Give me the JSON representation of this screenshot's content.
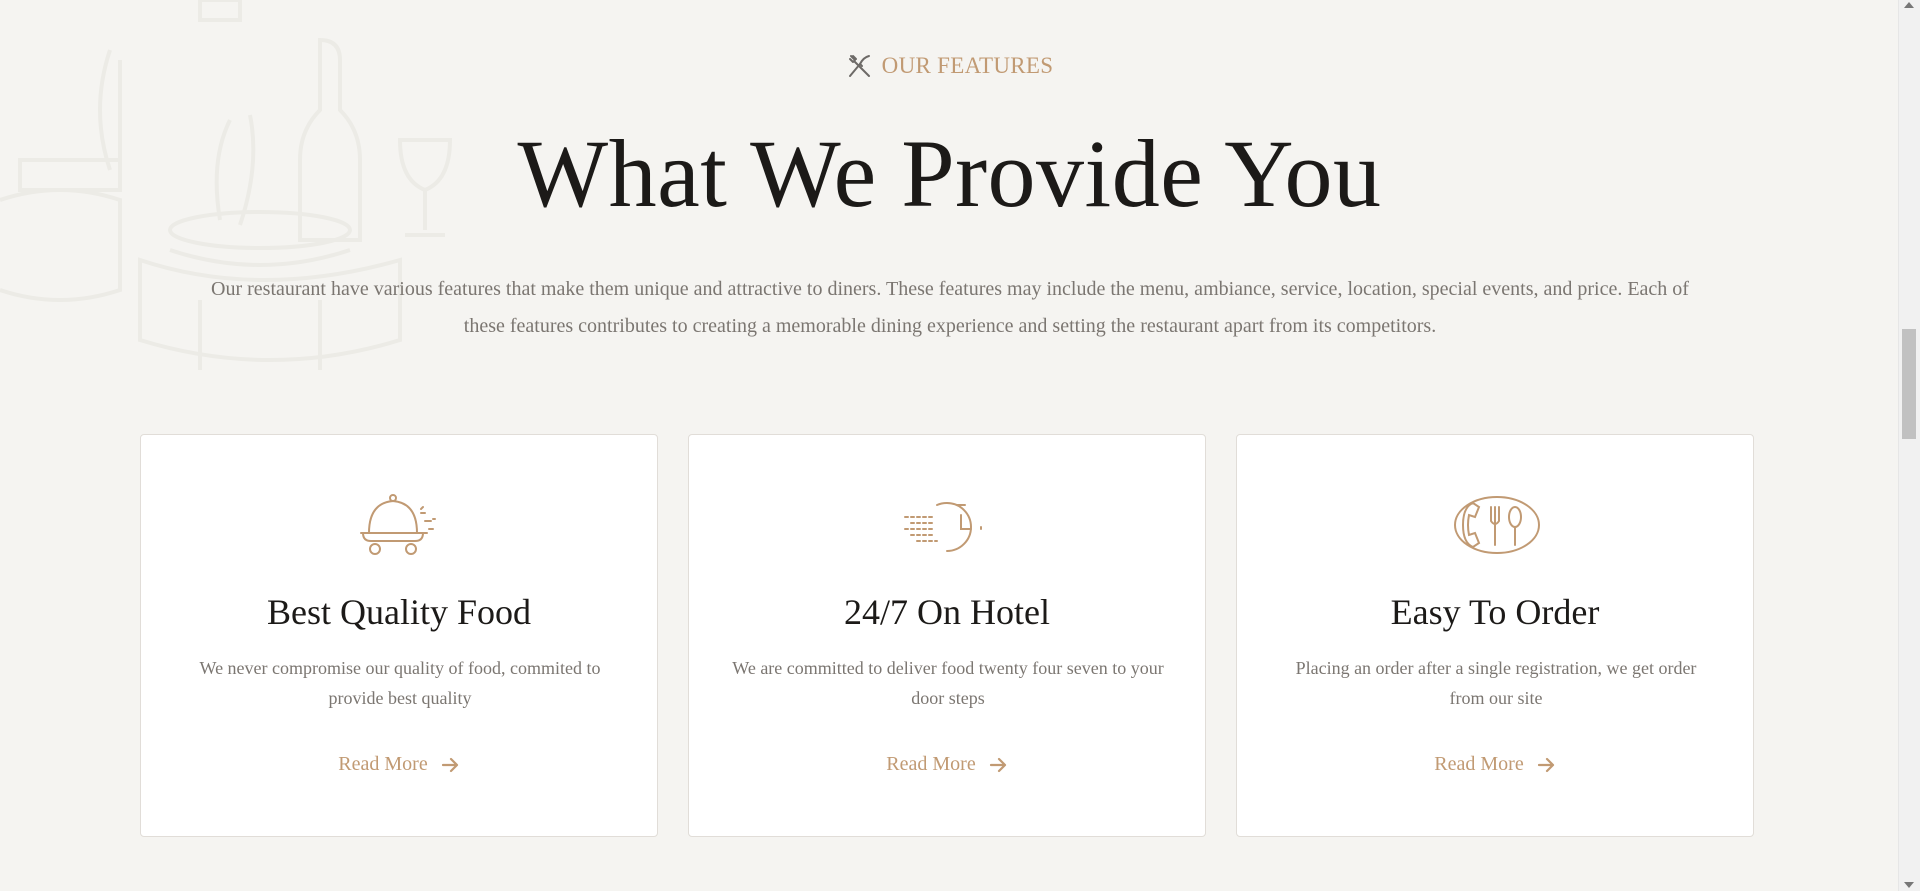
{
  "section": {
    "tag": "OUR FEATURES",
    "tag_icon": "fork-knife-icon",
    "title": "What We Provide You",
    "intro": "Our restaurant have various features that make them unique and attractive to diners. These features may include the menu, ambiance, service, location, special events, and price. Each of these features contributes to creating a memorable dining experience and setting the restaurant apart from its competitors."
  },
  "cards": [
    {
      "icon": "food-cloche-icon",
      "title": "Best Quality Food",
      "description": "We never compromise our quality of food, commited to provide best quality",
      "link_label": "Read More"
    },
    {
      "icon": "clock-delivery-icon",
      "title": "24/7 On Hotel",
      "description": "We are committed to deliver food twenty four seven to your door steps",
      "link_label": "Read More"
    },
    {
      "icon": "phone-order-icon",
      "title": "Easy To Order",
      "description": "Placing an order after a single registration, we get order from our site",
      "link_label": "Read More"
    }
  ],
  "colors": {
    "accent": "#c19a73",
    "heading": "#1c1a18",
    "body_text": "#7b7671",
    "background": "#f5f4f1",
    "card_background": "#ffffff"
  }
}
